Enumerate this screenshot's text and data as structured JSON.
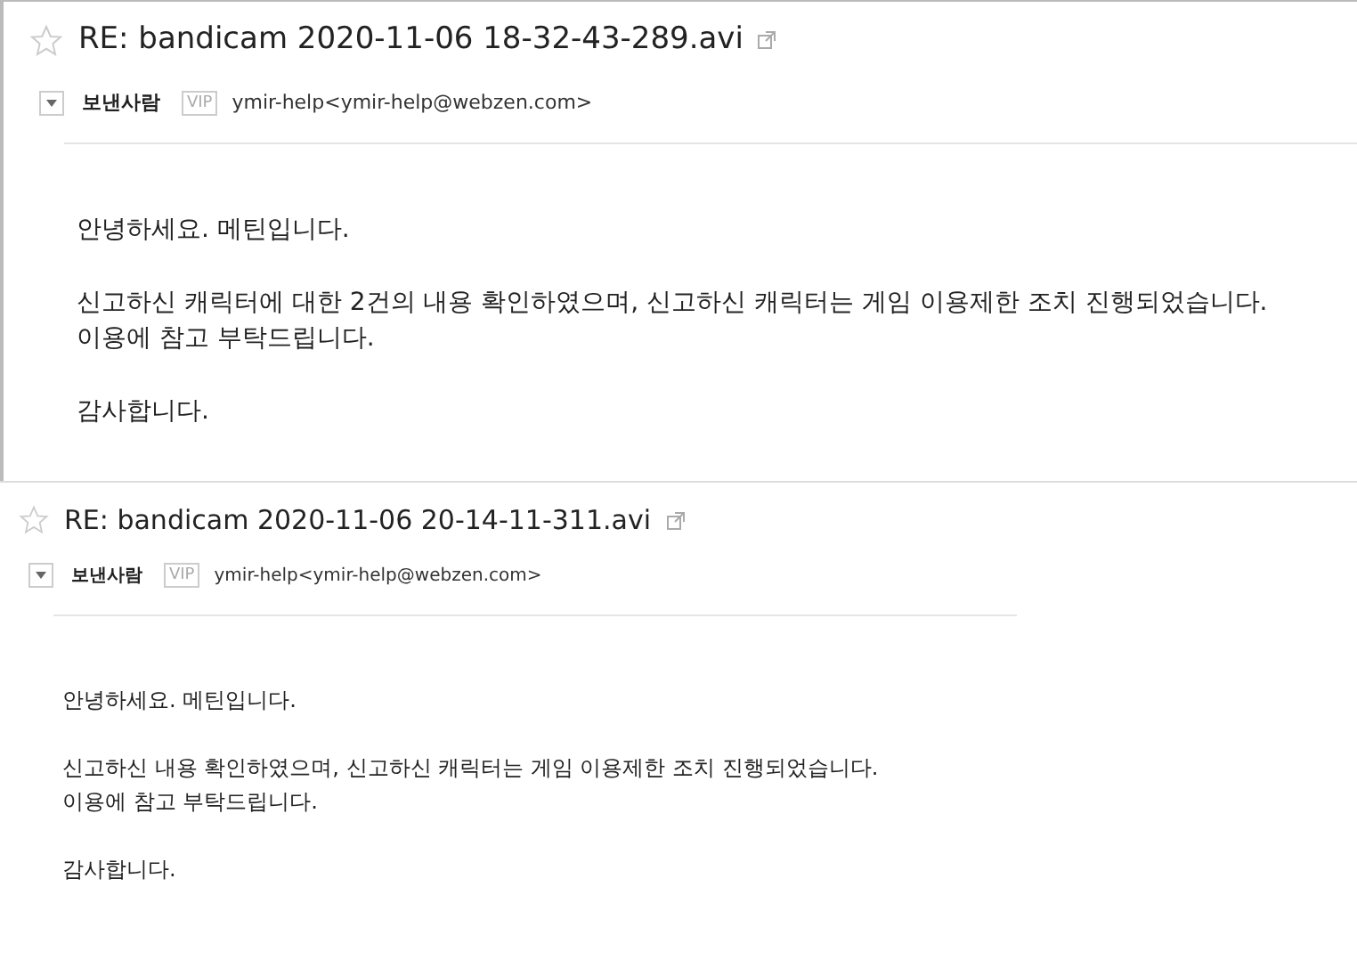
{
  "emails": [
    {
      "starred": false,
      "subject": "RE: bandicam 2020-11-06 18-32-43-289.avi",
      "sender_label": "보낸사람",
      "badge": "VIP",
      "sender": "ymir-help<ymir-help@webzen.com>",
      "paragraphs": [
        [
          "안녕하세요. 메틴입니다."
        ],
        [
          "신고하신 캐릭터에 대한 2건의 내용 확인하였으며, 신고하신 캐릭터는 게임 이용제한 조치 진행되었습니다.",
          "이용에 참고 부탁드립니다."
        ],
        [
          "감사합니다."
        ]
      ]
    },
    {
      "starred": false,
      "subject": "RE: bandicam 2020-11-06 20-14-11-311.avi",
      "sender_label": "보낸사람",
      "badge": "VIP",
      "sender": "ymir-help<ymir-help@webzen.com>",
      "paragraphs": [
        [
          "안녕하세요. 메틴입니다."
        ],
        [
          "신고하신 내용 확인하였으며, 신고하신 캐릭터는 게임 이용제한 조치 진행되었습니다.",
          "이용에 참고 부탁드립니다."
        ],
        [
          "감사합니다."
        ]
      ]
    }
  ]
}
